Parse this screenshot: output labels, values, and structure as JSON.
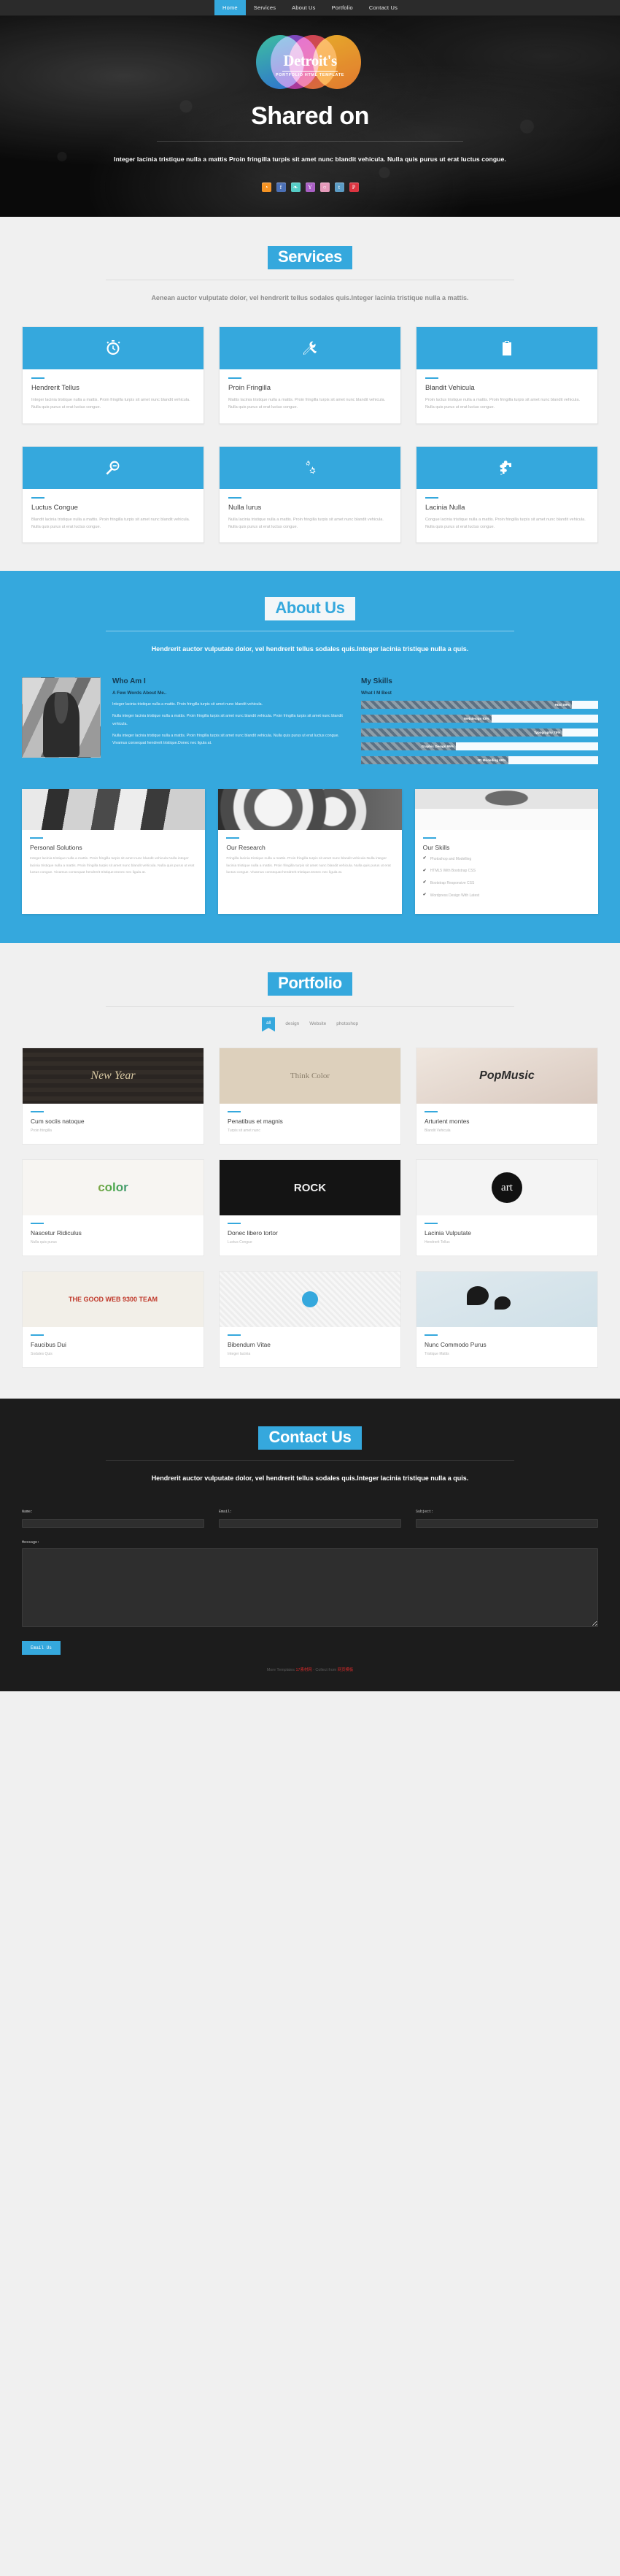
{
  "nav": {
    "items": [
      {
        "label": "Home",
        "active": true
      },
      {
        "label": "Services",
        "active": false
      },
      {
        "label": "About Us",
        "active": false
      },
      {
        "label": "Portfolio",
        "active": false
      },
      {
        "label": "Contact Us",
        "active": false
      }
    ]
  },
  "hero": {
    "logo_main": "Detroit's",
    "logo_sub": "PORTFOLIO HTML TEMPLATE",
    "title": "Shared on",
    "paragraph": "Integer lacinia tristique nulla a mattis Proin fringilla turpis sit amet nunc blandit vehicula. Nulla quis purus ut erat luctus congue.",
    "social": [
      {
        "name": "rss-icon",
        "glyph": "◔",
        "color": "#f59323"
      },
      {
        "name": "facebook-icon",
        "glyph": "f",
        "color": "#4a6fb5"
      },
      {
        "name": "twitter-icon",
        "glyph": "❧",
        "color": "#54ccc6"
      },
      {
        "name": "yahoo-icon",
        "glyph": "Y",
        "color": "#a95fc4"
      },
      {
        "name": "dribbble-icon",
        "glyph": "○",
        "color": "#e59aba"
      },
      {
        "name": "tumblr-icon",
        "glyph": "t",
        "color": "#5b9bc4"
      },
      {
        "name": "pinterest-icon",
        "glyph": "P",
        "color": "#dc3440"
      }
    ]
  },
  "services": {
    "title": "Services",
    "subtitle": "Aenean auctor vulputate dolor, vel hendrerit tellus sodales quis.Integer lacinia tristique nulla a mattis.",
    "cards": [
      {
        "icon": "stopwatch-icon",
        "title": "Hendrerit Tellus",
        "text": "Integer lacinia tristique nulla a mattis. Proin fringilla turpis sit amet nunc blandit vehicula. Nulla quis purus ut erat luctus congue."
      },
      {
        "icon": "tools-icon",
        "title": "Proin Fringilla",
        "text": "Mattis lacinia tristique nulla a mattis. Proin fringilla turpis sit amet nunc blandit vehicula. Nulla quis purus ut erat luctus congue."
      },
      {
        "icon": "clipboard-icon",
        "title": "Blandit Vehicula",
        "text": "Proin luctus tristique nulla a mattis. Proin fringilla turpis sit amet nunc blandit vehicula. Nulla quis purus ut erat luctus congue."
      },
      {
        "icon": "magnifier-icon",
        "title": "Luctus Congue",
        "text": "Blandit lacinia tristique nulla a mattis. Proin fringilla turpis sit amet nunc blandit vehicula. Nulla quis purus ut erat luctus congue."
      },
      {
        "icon": "gears-icon",
        "title": "Nulla Iurus",
        "text": "Nulla lacinia tristique nulla a mattis. Proin fringilla turpis sit amet nunc blandit vehicula. Nulla quis purus ut erat luctus congue."
      },
      {
        "icon": "puzzle-icon",
        "title": "Lacinia Nulla",
        "text": "Congue lacinia tristique nulla a mattis. Proin fringilla turpis sit amet nunc blandit vehicula. Nulla quis purus ut erat luctus congue."
      }
    ]
  },
  "about": {
    "title": "About Us",
    "subtitle": "Hendrerit auctor vulputate dolor, vel hendrerit tellus sodales quis.Integer lacinia tristique nulla a quis.",
    "who_heading": "Who Am I",
    "who_sub": "A Few Words About Me..",
    "who_p1": "Integer lacinia tristique nulla a mattis. Proin fringilla turpis sit amet nunc blandit vehicula.",
    "who_p2": "Nulla integer lacinia tristique nulla a mattis. Proin fringilla turpis sit amet nunc blandit vehicula. Proin fringilla turpis sit amet nunc blandit vehicula.",
    "who_p3": "Nulla integer lacinia tristique nulla a mattis. Proin fringilla turpis sit amet nunc blandit vehicula. Nulla quis purus ut erat luctus congue. Vivamus consequat hendrerit tristique.Donec nec ligula at.",
    "skills_heading": "My Skills",
    "skills_sub": "What I M Best",
    "skills": [
      {
        "label": "Html 89%",
        "value": 89
      },
      {
        "label": "Webdesign 93%",
        "value": 93
      },
      {
        "label": "Typography 75%",
        "value": 75
      },
      {
        "label": "Graphic Design 96%",
        "value": 96
      },
      {
        "label": "3D Modelling 66%",
        "value": 66
      }
    ],
    "cards": [
      {
        "title": "Personal Solutions",
        "text": "Integer lacinia tristique nulla a mattis. Proin fringilla turpis sit amet nunc blandit vehicula Nulla integer lacinia tristique nulla a mattis. Proin fringilla turpis sit amet nunc blandit vehicula. Nulla quis purus ut erat luctus congue. Vivamus consequat hendrerit tristique.Donec nec ligula at."
      },
      {
        "title": "Our Research",
        "text": "Fringilla lacinia tristique nulla a mattis. Proin fringilla turpis sit amet nunc blandit vehicula Nulla integer lacinia tristique nulla a mattis. Proin fringilla turpis sit amet nunc blandit vehicula. Nulla quis purus ut erat luctus congue. Vivamus consequat hendrerit tristique.Donec nec ligula at."
      },
      {
        "title": "Our Skills",
        "list": [
          "Photoshop and Modelling",
          "HTML5 With Bootstrap CSS",
          "Bootstrap Responsive CSS",
          "Wordpress Design With Latest"
        ]
      }
    ]
  },
  "portfolio": {
    "title": "Portfolio",
    "filters": [
      {
        "label": "all",
        "active": true
      },
      {
        "label": "design",
        "active": false
      },
      {
        "label": "Website",
        "active": false
      },
      {
        "label": "photoshop",
        "active": false
      }
    ],
    "items": [
      {
        "thumb": "t1",
        "title": "Cum sociis natoque",
        "category": "Proin fringilla"
      },
      {
        "thumb": "t2",
        "title": "Penatibus et magnis",
        "category": "Turpis sit amet nunc"
      },
      {
        "thumb": "t3",
        "title": "Arturient montes",
        "category": "Blandit Vehicula"
      },
      {
        "thumb": "t4",
        "title": "Nascetur Ridiculus",
        "category": "Nulla quis purus"
      },
      {
        "thumb": "t5",
        "title": "Donec libero tortor",
        "category": "Luctus Congue"
      },
      {
        "thumb": "t6",
        "title": "Lacinia Vulputate",
        "category": "Hendrerit Tellus"
      },
      {
        "thumb": "t7",
        "title": "Faucibus Dui",
        "category": "Sodales Quis"
      },
      {
        "thumb": "t8",
        "title": "Bibendum Vitae",
        "category": "Integer lacinia"
      },
      {
        "thumb": "t9",
        "title": "Nunc Commodo Purus",
        "category": "Tristique Mattis"
      }
    ]
  },
  "contact": {
    "title": "Contact Us",
    "subtitle": "Hendrerit auctor vulputate dolor, vel hendrerit tellus sodales quis.Integer lacinia tristique nulla a quis.",
    "fields": [
      {
        "label": "Name:",
        "value": ""
      },
      {
        "label": "Email:",
        "value": ""
      },
      {
        "label": "Subject:",
        "value": ""
      }
    ],
    "message_label": "Message:",
    "message_value": "",
    "submit_label": "Email Us"
  },
  "footer": {
    "prefix": "More Templates ",
    "link1": "17素材网",
    "middle": " - Collect from ",
    "link2": "网页模板"
  }
}
